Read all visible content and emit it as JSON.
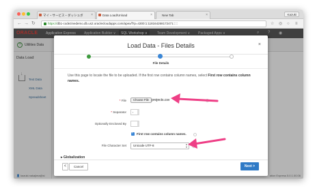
{
  "browser": {
    "user": "Kazuki",
    "tabs": [
      {
        "label": "マイ・サービス・ダッシュボ",
        "active": false
      },
      {
        "label": "Data Load/Unload",
        "active": true
      },
      {
        "label": "New Tab",
        "active": false
      }
    ],
    "url_scheme": "https://",
    "url_rest": "db1-codezinedemo.db.us2.oraclecloudapps.com/apex/f?p=4300:1:118164268172471:::::"
  },
  "apex": {
    "logo": "ORACLE",
    "title": "Application Express",
    "menu": [
      "Application Builder ∨",
      "SQL Workshop ∨",
      "Team Development ∨",
      "Packaged Apps ∨"
    ],
    "active_menu_index": 1
  },
  "breadcrumb": {
    "icon": "utilities-icon",
    "text": "Utilities   Data"
  },
  "sidebar": {
    "title": "Data Load",
    "items": [
      "Text Data",
      "XML Data",
      "Spreadsheet"
    ],
    "footer_user": "kazuki.nakajima@si",
    "version": "ation Express 5.0.1.00.06"
  },
  "modal": {
    "title": "Load Data - Files Details",
    "close_icon": "close-icon",
    "wizard_current_label": "File Details",
    "intro_plain": "Use this page to locate the file to be uploaded. If the first row contains column names, select ",
    "intro_bold": "First row contains column names.",
    "fields": {
      "file_label": "File",
      "choose_button": "Choose File",
      "file_name": "projects.csv",
      "separator_label": "Separator",
      "separator_value": ",",
      "enclosed_label": "Optionally Enclosed By",
      "enclosed_value": "",
      "first_row_label": "First row contains column names.",
      "first_row_checked": true,
      "charset_label": "File Character Set",
      "charset_value": "Unicode UTF-8"
    },
    "globalization": "Globalization",
    "buttons": {
      "back": "<",
      "cancel": "Cancel",
      "next": "Next >"
    }
  },
  "colors": {
    "apex_header": "#4c4c4c",
    "next_button": "#2f7ac6",
    "wizard_done": "#3d9a3d",
    "wizard_current": "#3a86d6",
    "annotation_arrow": "#ee3f86"
  }
}
